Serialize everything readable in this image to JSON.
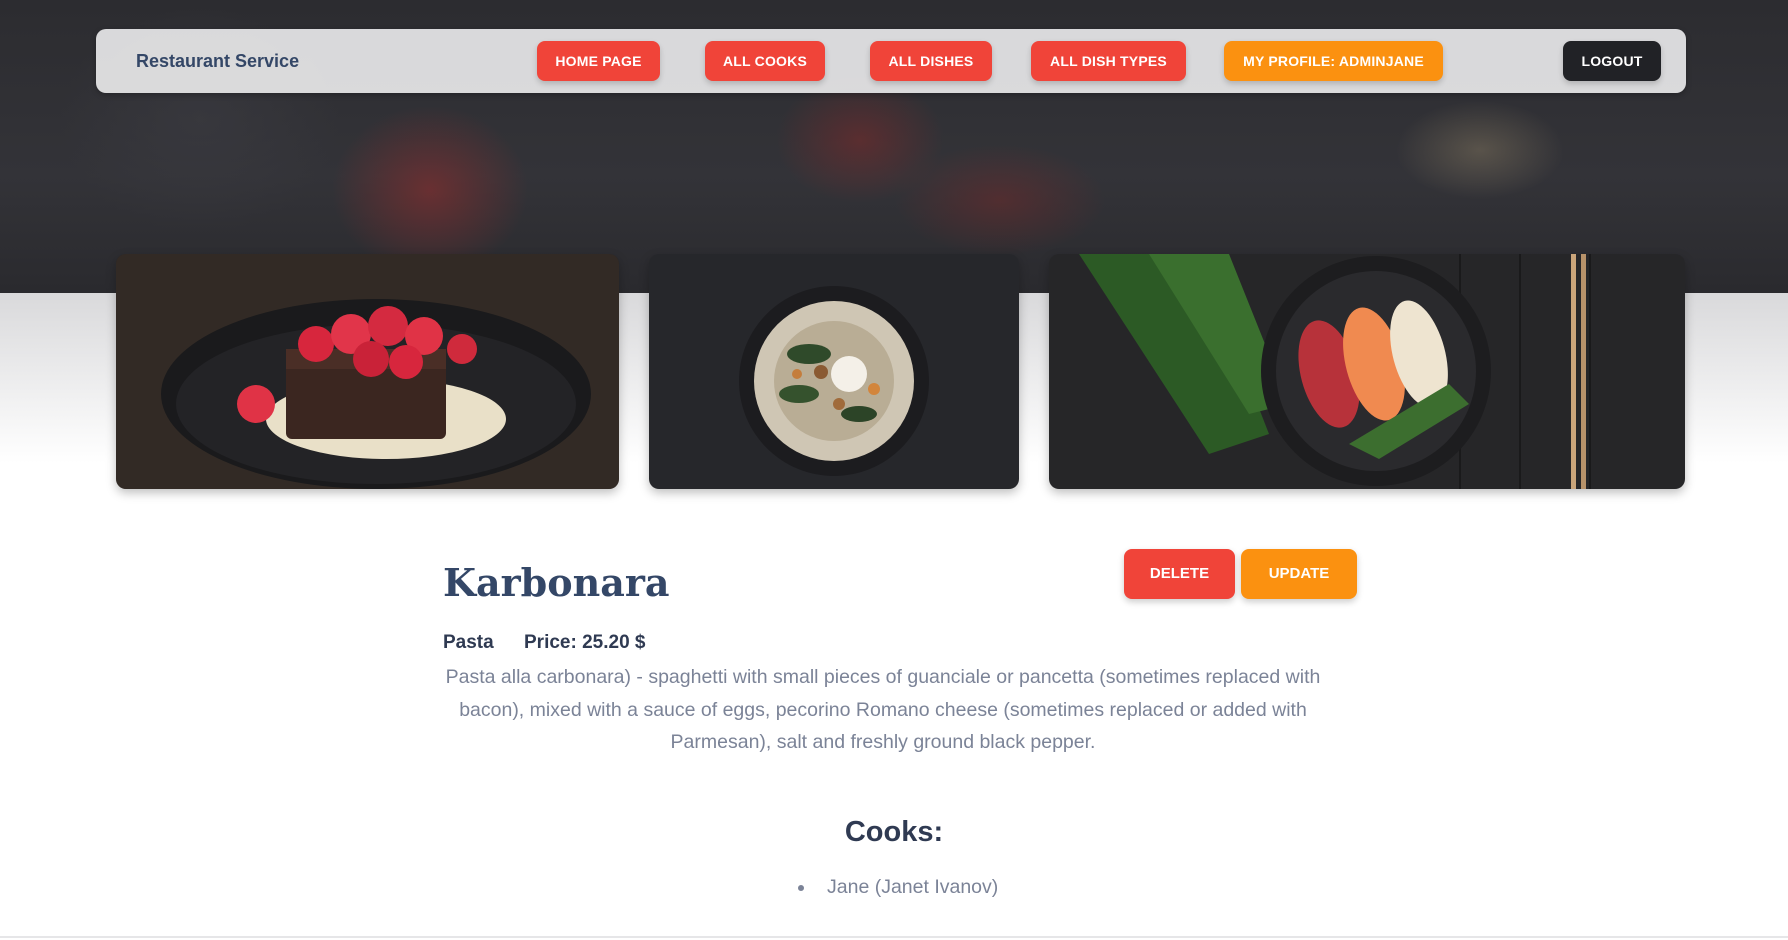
{
  "navbar": {
    "brand": "Restaurant Service",
    "items": [
      {
        "label": "HOME PAGE"
      },
      {
        "label": "ALL COOKS"
      },
      {
        "label": "ALL DISHES"
      },
      {
        "label": "ALL DISH TYPES"
      },
      {
        "label": "MY PROFILE: ADMINJANE"
      }
    ],
    "logout_label": "LOGOUT"
  },
  "gallery": [
    {
      "icon": "chocolate-cake-raspberries-image"
    },
    {
      "icon": "mushroom-soup-bowl-image"
    },
    {
      "icon": "sushi-plate-image"
    }
  ],
  "dish": {
    "name": "Karbonara",
    "type": "Pasta",
    "price": "Price: 25.20 $",
    "description": "Pasta alla carbonara) - spaghetti with small pieces of guanciale or pancetta (sometimes replaced with bacon), mixed with a sauce of eggs, pecorino Romano cheese (sometimes replaced or added with Parmesan), salt and freshly ground black pepper.",
    "delete_label": "DELETE",
    "update_label": "UPDATE"
  },
  "cooks": {
    "title": "Cooks:",
    "list": [
      "Jane (Janet Ivanov)"
    ]
  },
  "colors": {
    "primary_red": "#f04439",
    "accent_orange": "#fb9110",
    "dark": "#212226",
    "heading": "#344767",
    "body_text": "#7b8397"
  }
}
